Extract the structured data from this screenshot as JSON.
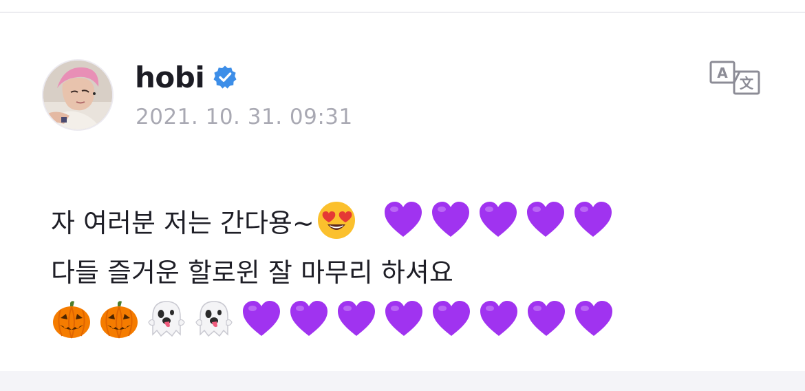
{
  "post": {
    "author": "hobi",
    "verified": true,
    "timestamp": "2021. 10. 31. 09:31",
    "lines": [
      {
        "text": "자 여러분 저는 간다용~",
        "emojis": [
          "heart-eyes-emoji",
          "purple-heart-emoji",
          "purple-heart-emoji",
          "purple-heart-emoji",
          "purple-heart-emoji",
          "purple-heart-emoji"
        ]
      },
      {
        "text": "다들 즐거운 할로윈 잘 마무리 하셔요",
        "emojis": []
      },
      {
        "text": "",
        "emojis": [
          "jack-o-lantern-emoji",
          "jack-o-lantern-emoji",
          "ghost-emoji",
          "ghost-emoji",
          "purple-heart-emoji",
          "purple-heart-emoji",
          "purple-heart-emoji",
          "purple-heart-emoji",
          "purple-heart-emoji",
          "purple-heart-emoji",
          "purple-heart-emoji",
          "purple-heart-emoji"
        ]
      }
    ]
  },
  "icons": {
    "verified": "verified-badge-icon",
    "translate": "translate-icon"
  },
  "colors": {
    "verified_blue": "#3d8ee8",
    "author_text": "#1c1c24",
    "timestamp_text": "#a9a9b3",
    "body_text": "#1e1e26",
    "purple_heart": "#a033f0",
    "divider": "#ececf0",
    "bottom_band": "#f4f4f8"
  }
}
